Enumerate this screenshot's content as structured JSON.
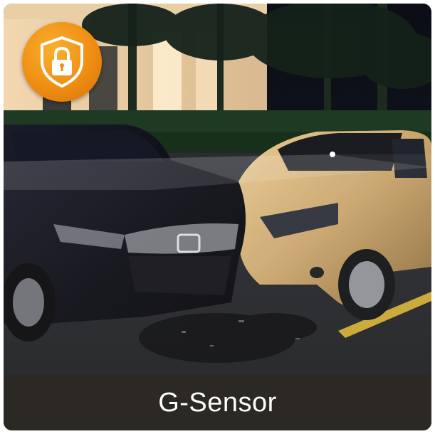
{
  "badge": {
    "icon": "shield-lock-icon",
    "color": "#f29a1a"
  },
  "caption": {
    "text": "G-Sensor"
  },
  "colors": {
    "caption_bar": "#2c2824",
    "caption_text": "#ffffff"
  }
}
